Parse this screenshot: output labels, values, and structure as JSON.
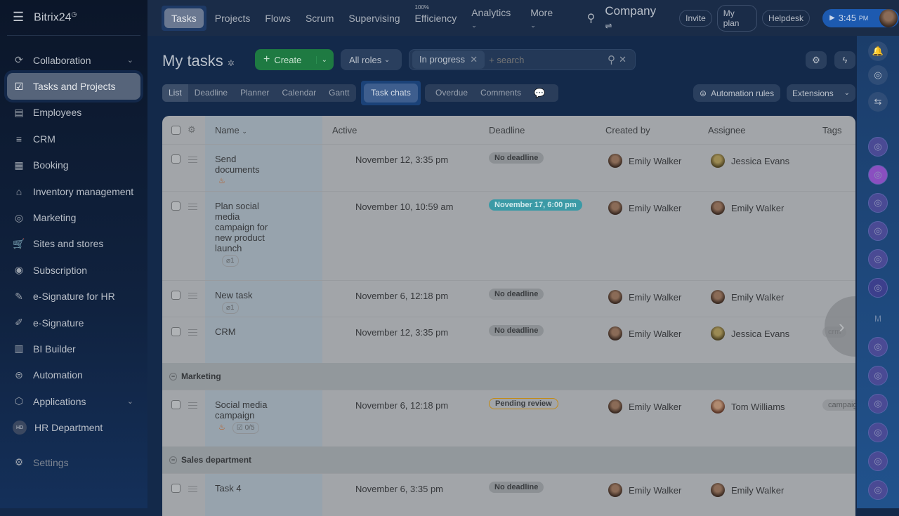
{
  "app": {
    "logo": "Bitrix24"
  },
  "sidebar": {
    "items": [
      {
        "label": "Collaboration",
        "icon": "collaboration-icon",
        "chevron": true
      },
      {
        "label": "Tasks and Projects",
        "icon": "checkbox-icon",
        "active": true
      },
      {
        "label": "Employees",
        "icon": "employees-icon"
      },
      {
        "label": "CRM",
        "icon": "crm-funnel-icon"
      },
      {
        "label": "Booking",
        "icon": "calendar-icon"
      },
      {
        "label": "Inventory management",
        "icon": "warehouse-icon"
      },
      {
        "label": "Marketing",
        "icon": "target-icon"
      },
      {
        "label": "Sites and stores",
        "icon": "cart-icon"
      },
      {
        "label": "Subscription",
        "icon": "subscription-icon"
      },
      {
        "label": "e-Signature for HR",
        "icon": "document-sign-icon"
      },
      {
        "label": "e-Signature",
        "icon": "pen-icon"
      },
      {
        "label": "BI Builder",
        "icon": "bar-chart-icon"
      },
      {
        "label": "Automation",
        "icon": "robot-icon"
      },
      {
        "label": "Applications",
        "icon": "cube-icon",
        "chevron": true
      },
      {
        "label": "HR Department",
        "icon": "hd-avatar",
        "avatar": "HD"
      }
    ],
    "settings": "Settings"
  },
  "topnav": {
    "items": [
      "Tasks",
      "Projects",
      "Flows",
      "Scrum",
      "Supervising",
      "Efficiency",
      "Analytics",
      "More"
    ],
    "efficiency_value": "100%",
    "company": "Company",
    "invite": "Invite",
    "my_plan": "My plan",
    "helpdesk": "Helpdesk",
    "time": "3:45",
    "ampm": "PM"
  },
  "toolbar": {
    "title": "My tasks",
    "create": "Create",
    "roles": "All roles",
    "filter_chip": "In progress",
    "search_placeholder": "+ search",
    "automation": "Automation rules",
    "extensions": "Extensions"
  },
  "views": [
    "List",
    "Deadline",
    "Planner",
    "Calendar",
    "Gantt"
  ],
  "task_chats": "Task chats",
  "counters": [
    "Overdue",
    "Comments"
  ],
  "table": {
    "columns": [
      "Name",
      "Active",
      "Deadline",
      "Created by",
      "Assignee",
      "Tags"
    ],
    "rows": [
      {
        "name": "Send documents",
        "active": "November 12, 3:35 pm",
        "deadline": "No deadline",
        "created_by": "Emily Walker",
        "assignee": "Jessica Evans",
        "hot": true
      },
      {
        "name": "Plan social media campaign for new product launch",
        "active": "November 10, 10:59 am",
        "deadline": "November 17, 6:00 pm",
        "created_by": "Emily Walker",
        "assignee": "Emily Walker",
        "attachments": "1"
      },
      {
        "name": "New task",
        "active": "November 6, 12:18 pm",
        "deadline": "No deadline",
        "created_by": "Emily Walker",
        "assignee": "Emily Walker",
        "attachments": "1"
      },
      {
        "name": "CRM",
        "active": "November 12, 3:35 pm",
        "deadline": "No deadline",
        "created_by": "Emily Walker",
        "assignee": "Jessica Evans",
        "tag": "crm"
      }
    ],
    "groups": [
      {
        "name": "Marketing",
        "rows": [
          {
            "name": "Social media campaign",
            "active": "November 6, 12:18 pm",
            "deadline": "Pending review",
            "created_by": "Emily Walker",
            "assignee": "Tom Williams",
            "tag": "campaign",
            "hot": true,
            "checklist": "0/5"
          }
        ]
      },
      {
        "name": "Sales department",
        "rows": [
          {
            "name": "Task 4",
            "active": "November 6, 3:35 pm",
            "deadline": "No deadline",
            "created_by": "Emily Walker",
            "assignee": "Emily Walker"
          }
        ]
      }
    ]
  },
  "rail": {
    "letter": "M"
  }
}
